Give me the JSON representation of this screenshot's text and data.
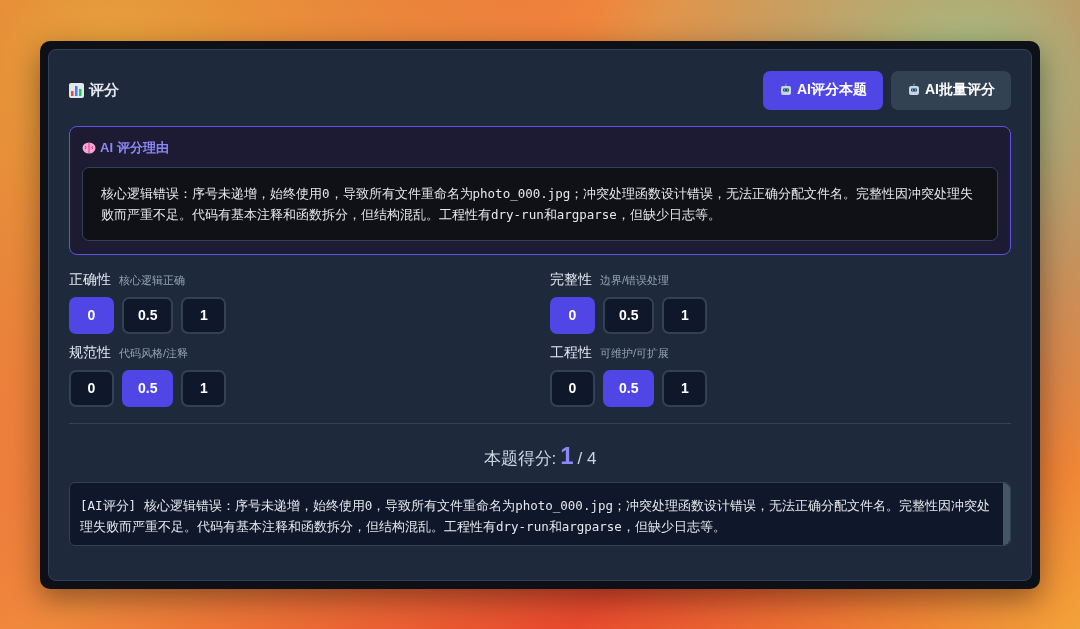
{
  "header": {
    "title": "评分",
    "buttons": [
      {
        "label": "AI评分本题",
        "kind": "primary"
      },
      {
        "label": "AI批量评分",
        "kind": "secondary"
      }
    ]
  },
  "reason": {
    "title": "AI 评分理由",
    "text": "核心逻辑错误：序号未递增，始终使用0，导致所有文件重命名为photo_000.jpg；冲突处理函数设计错误，无法正确分配文件名。完整性因冲突处理失败而严重不足。代码有基本注释和函数拆分，但结构混乱。工程性有dry-run和argparse，但缺少日志等。"
  },
  "criteria": [
    {
      "name": "正确性",
      "hint": "核心逻辑正确",
      "options": [
        {
          "label": "0",
          "selected": true
        },
        {
          "label": "0.5",
          "selected": false
        },
        {
          "label": "1",
          "selected": false
        }
      ]
    },
    {
      "name": "完整性",
      "hint": "边界/错误处理",
      "options": [
        {
          "label": "0",
          "selected": true
        },
        {
          "label": "0.5",
          "selected": false
        },
        {
          "label": "1",
          "selected": false
        }
      ]
    },
    {
      "name": "规范性",
      "hint": "代码风格/注释",
      "options": [
        {
          "label": "0",
          "selected": false
        },
        {
          "label": "0.5",
          "selected": true
        },
        {
          "label": "1",
          "selected": false
        }
      ]
    },
    {
      "name": "工程性",
      "hint": "可维护/可扩展",
      "options": [
        {
          "label": "0",
          "selected": false
        },
        {
          "label": "0.5",
          "selected": true
        },
        {
          "label": "1",
          "selected": false
        }
      ]
    }
  ],
  "score": {
    "label": "本题得分:",
    "value": "1",
    "total": "/ 4"
  },
  "comment": "[AI评分] 核心逻辑错误：序号未递增，始终使用0，导致所有文件重命名为photo_000.jpg；冲突处理函数设计错误，无法正确分配文件名。完整性因冲突处理失败而严重不足。代码有基本注释和函数拆分，但结构混乱。工程性有dry-run和argparse，但缺少日志等。"
}
